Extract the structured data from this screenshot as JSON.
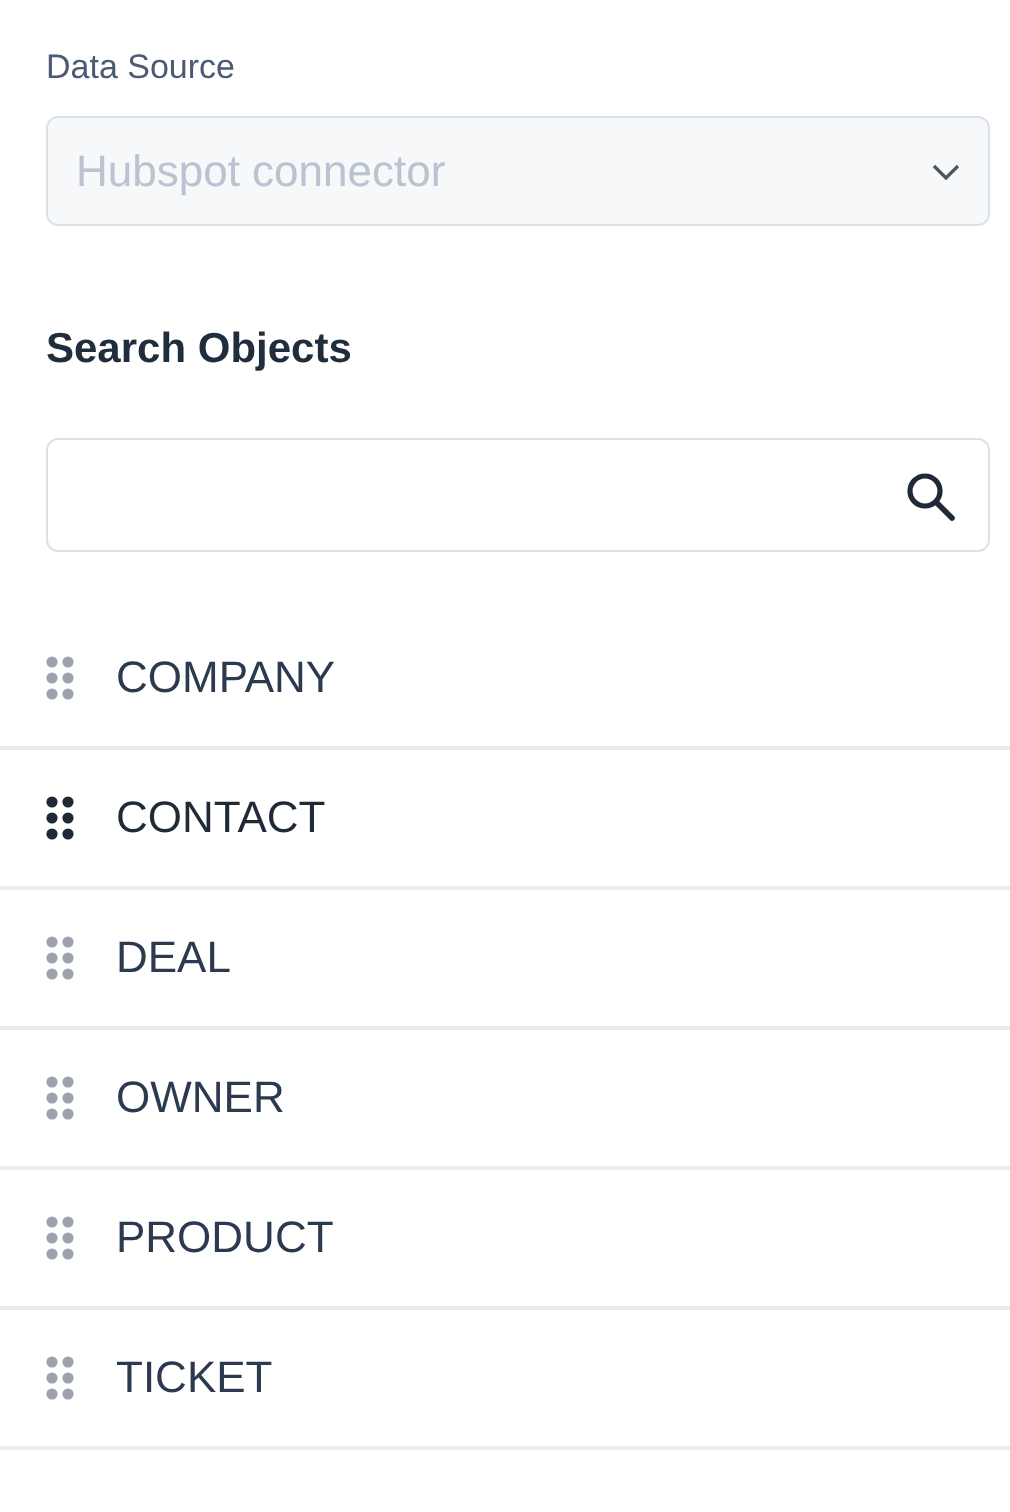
{
  "data_source": {
    "label": "Data Source",
    "value": "Hubspot connector",
    "disabled": true
  },
  "search": {
    "heading": "Search Objects"
  },
  "objects": [
    {
      "name": "COMPANY",
      "selected": false
    },
    {
      "name": "CONTACT",
      "selected": true
    },
    {
      "name": "DEAL",
      "selected": false
    },
    {
      "name": "OWNER",
      "selected": false
    },
    {
      "name": "PRODUCT",
      "selected": false
    },
    {
      "name": "TICKET",
      "selected": false
    }
  ]
}
